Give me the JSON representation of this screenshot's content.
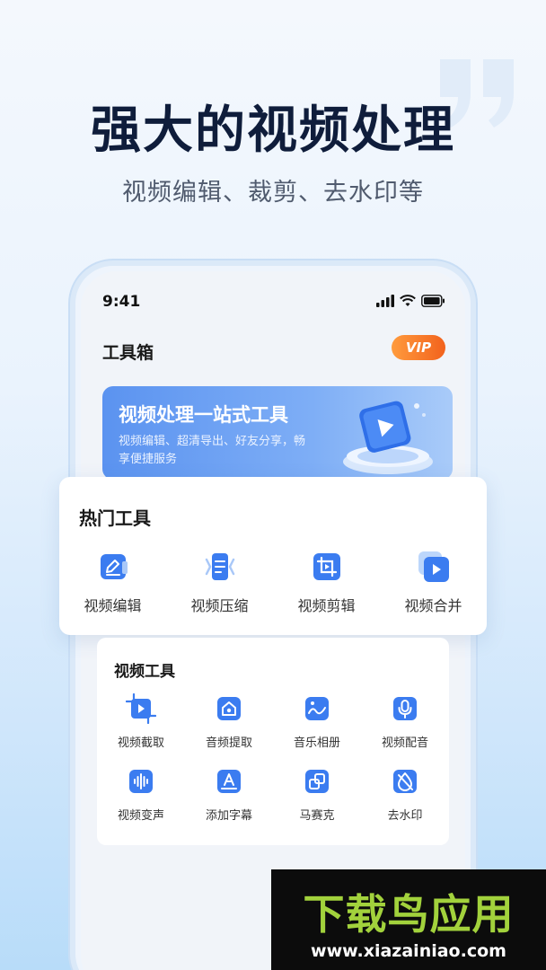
{
  "promo": {
    "headline": "强大的视频处理",
    "subline": "视频编辑、裁剪、去水印等"
  },
  "status_bar": {
    "time": "9:41"
  },
  "header": {
    "title": "工具箱",
    "vip_label": "VIP"
  },
  "banner": {
    "title": "视频处理一站式工具",
    "description": "视频编辑、超清导出、好友分享，畅享便捷服务"
  },
  "hot_tools": {
    "title": "热门工具",
    "items": [
      {
        "label": "视频编辑",
        "icon": "pencil-edit-icon"
      },
      {
        "label": "视频压缩",
        "icon": "compress-icon"
      },
      {
        "label": "视频剪辑",
        "icon": "crop-icon"
      },
      {
        "label": "视频合并",
        "icon": "merge-play-icon"
      }
    ]
  },
  "video_tools": {
    "title": "视频工具",
    "items": [
      {
        "label": "视频截取",
        "icon": "crop-play-icon"
      },
      {
        "label": "音频提取",
        "icon": "audio-extract-icon"
      },
      {
        "label": "音乐相册",
        "icon": "music-album-icon"
      },
      {
        "label": "视频配音",
        "icon": "microphone-icon"
      },
      {
        "label": "视频变声",
        "icon": "voice-wave-icon"
      },
      {
        "label": "添加字幕",
        "icon": "subtitle-icon"
      },
      {
        "label": "马赛克",
        "icon": "mosaic-icon"
      },
      {
        "label": "去水印",
        "icon": "remove-watermark-icon"
      }
    ]
  },
  "watermark": {
    "logo_text": "下载鸟应用",
    "url": "www.xiazainiao.com"
  },
  "colors": {
    "accent": "#3b7cf0",
    "vip_start": "#ff9b3d",
    "vip_end": "#f2621d",
    "headline": "#0f1d3b",
    "watermark_green": "#a2d23c"
  }
}
